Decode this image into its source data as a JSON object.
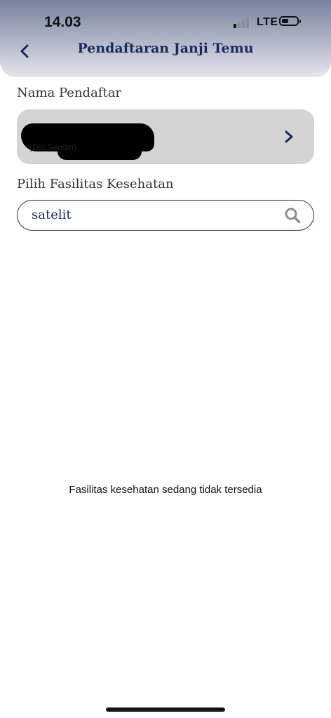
{
  "status_bar": {
    "time": "14.03",
    "network": "LTE",
    "icons": [
      "signal-icon",
      "battery-icon"
    ]
  },
  "header": {
    "title": "Pendaftaran Janji Temu",
    "back_icon": "chevron-left-icon"
  },
  "registrant": {
    "section_label": "Nama Pendaftar",
    "relation": "(Diri Sendiri)",
    "chevron_icon": "chevron-right-icon"
  },
  "facility": {
    "section_label": "Pilih Fasilitas Kesehatan",
    "search_value": "satelit",
    "search_icon": "search-icon"
  },
  "empty_state": {
    "message": "Fasilitas kesehatan sedang tidak tersedia"
  },
  "colors": {
    "primary": "#1b2a5a",
    "card_bg": "#d4d4d4",
    "header_gradient_top": "#7a819f",
    "header_gradient_bottom": "#e4e5ec"
  }
}
